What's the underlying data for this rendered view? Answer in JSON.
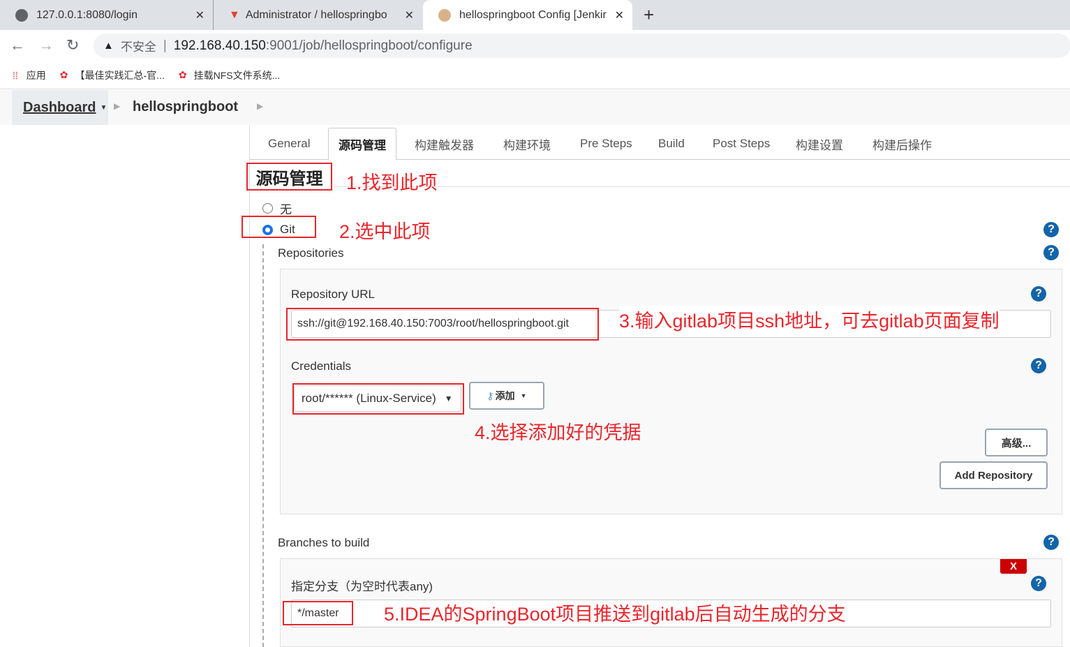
{
  "browser": {
    "tabs": [
      {
        "title": "127.0.0.1:8080/login",
        "icon": "globe-icon"
      },
      {
        "title": "Administrator / hellospringbo",
        "icon": "gitlab-icon"
      },
      {
        "title": "hellospringboot Config [Jenkir",
        "icon": "jenkins-icon"
      }
    ],
    "security": "不安全",
    "url_host": "192.168.40.150",
    "url_rest": ":9001/job/hellospringboot/configure",
    "bookmarks": [
      {
        "label": "应用"
      },
      {
        "label": "【最佳实践汇总-官..."
      },
      {
        "label": "挂载NFS文件系统..."
      }
    ]
  },
  "breadcrumb": {
    "dashboard": "Dashboard",
    "job": "hellospringboot"
  },
  "config_tabs": [
    "General",
    "源码管理",
    "构建触发器",
    "构建环境",
    "Pre Steps",
    "Build",
    "Post Steps",
    "构建设置",
    "构建后操作"
  ],
  "section_title": "源码管理",
  "scm": {
    "none_label": "无",
    "git_label": "Git",
    "selected": "Git"
  },
  "repositories": {
    "label": "Repositories",
    "url_label": "Repository URL",
    "url_value": "ssh://git@192.168.40.150:7003/root/hellospringboot.git",
    "credentials_label": "Credentials",
    "credentials_value": "root/****** (Linux-Service)",
    "add_label": "添加",
    "advanced_label": "高级...",
    "add_repository_label": "Add Repository"
  },
  "branches": {
    "label": "Branches to build",
    "spec_label": "指定分支（为空时代表any)",
    "spec_value": "*/master",
    "delete_label": "X"
  },
  "annotations": [
    "1.找到此项",
    "2.选中此项",
    "3.输入gitlab项目ssh地址，可去gitlab页面复制",
    "4.选择添加好的凭据",
    "5.IDEA的SpringBoot项目推送到gitlab后自动生成的分支"
  ],
  "colors": {
    "annotation": "#e8262c",
    "help": "#1364a8",
    "delete": "#cc0000"
  }
}
